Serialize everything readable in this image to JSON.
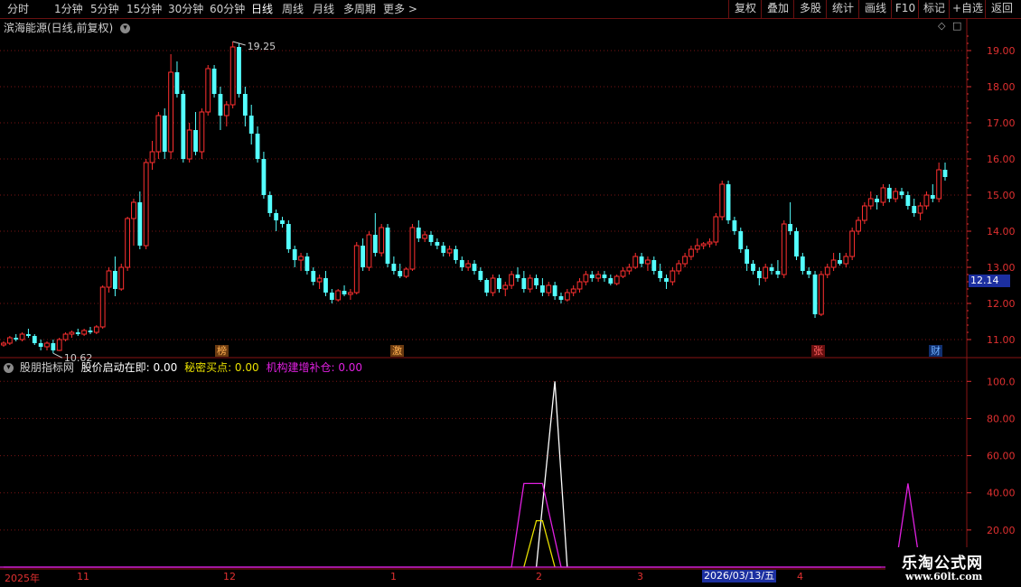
{
  "toolbar": {
    "periods": [
      "分时",
      "1分钟",
      "5分钟",
      "15分钟",
      "30分钟",
      "60分钟",
      "日线",
      "周线",
      "月线",
      "多周期",
      "更多 >"
    ],
    "active_period": "日线",
    "right_buttons": [
      "复权",
      "叠加",
      "多股",
      "统计",
      "画线",
      "F10",
      "标记",
      "+自选",
      "返回"
    ]
  },
  "chart_header": {
    "title": "滨海能源(日线,前复权)"
  },
  "indicator": {
    "name": "股朋指标网",
    "line1_label": "股价启动在即: 0.00",
    "line2_label": "秘密买点: 0.00",
    "line3_label": "机构建增补仓: 0.00"
  },
  "annotations": {
    "high_label": "19.25",
    "low_label": "10.62",
    "current_price": "12.14"
  },
  "event_tags": [
    {
      "text": "榜",
      "color": "#e07a1a"
    },
    {
      "text": "激",
      "color": "#e07a1a"
    },
    {
      "text": "张",
      "color": "#e03030"
    },
    {
      "text": "财",
      "color": "#2a7ae0"
    }
  ],
  "date_axis": [
    "2025年",
    "11",
    "12",
    "1",
    "2",
    "3",
    "2026/03/13/五",
    "4"
  ],
  "watermark": {
    "title": "乐淘公式网",
    "url": "www.60lt.com"
  },
  "colors": {
    "up": "#ff3030",
    "down": "#54ffff",
    "grid": "#7a1414",
    "axis_text": "#e03030",
    "ind_white": "#ffffff",
    "ind_yellow": "#e8e000",
    "ind_magenta": "#e020e0"
  },
  "chart_data": [
    {
      "type": "candlestick",
      "title": "滨海能源(日线,前复权)",
      "ylim": [
        10.6,
        19.5
      ],
      "y_ticks": [
        11.0,
        12.0,
        13.0,
        14.0,
        15.0,
        16.0,
        17.0,
        18.0,
        19.0
      ],
      "y_tick_labels": [
        "11.00",
        "12.00",
        "13.00",
        "14.00",
        "15.00",
        "16.00",
        "17.00",
        "18.00",
        "19.00"
      ],
      "x_labels": [
        "2025年",
        "11",
        "12",
        "1",
        "2",
        "3",
        "4"
      ],
      "ohlc": [
        [
          10.85,
          10.95,
          10.8,
          10.9
        ],
        [
          10.9,
          11.1,
          10.85,
          11.05
        ],
        [
          11.05,
          11.15,
          10.95,
          11.0
        ],
        [
          11.0,
          11.2,
          10.95,
          11.15
        ],
        [
          11.15,
          11.3,
          11.05,
          11.1
        ],
        [
          11.1,
          11.15,
          10.85,
          10.9
        ],
        [
          10.9,
          11.0,
          10.7,
          10.8
        ],
        [
          10.8,
          10.95,
          10.7,
          10.9
        ],
        [
          10.9,
          11.0,
          10.62,
          10.7
        ],
        [
          10.7,
          11.05,
          10.68,
          11.0
        ],
        [
          11.0,
          11.2,
          10.95,
          11.15
        ],
        [
          11.15,
          11.25,
          11.05,
          11.2
        ],
        [
          11.2,
          11.3,
          11.1,
          11.15
        ],
        [
          11.15,
          11.3,
          11.1,
          11.25
        ],
        [
          11.25,
          11.35,
          11.15,
          11.2
        ],
        [
          11.2,
          11.4,
          11.15,
          11.35
        ],
        [
          11.35,
          12.5,
          11.3,
          12.45
        ],
        [
          12.45,
          13.0,
          12.3,
          12.9
        ],
        [
          12.9,
          13.3,
          12.2,
          12.4
        ],
        [
          12.4,
          13.1,
          12.35,
          13.0
        ],
        [
          13.0,
          14.4,
          12.9,
          14.35
        ],
        [
          14.35,
          14.9,
          13.6,
          14.8
        ],
        [
          14.8,
          15.1,
          13.5,
          13.6
        ],
        [
          13.6,
          16.0,
          13.5,
          15.9
        ],
        [
          15.9,
          16.5,
          15.7,
          16.2
        ],
        [
          16.2,
          17.3,
          16.0,
          17.2
        ],
        [
          17.2,
          17.4,
          16.0,
          16.2
        ],
        [
          16.2,
          18.9,
          16.0,
          18.4
        ],
        [
          18.4,
          18.7,
          17.7,
          17.8
        ],
        [
          17.8,
          17.9,
          15.9,
          16.0
        ],
        [
          16.0,
          17.0,
          15.9,
          16.8
        ],
        [
          16.8,
          17.3,
          16.1,
          16.2
        ],
        [
          16.2,
          17.4,
          16.0,
          17.3
        ],
        [
          17.3,
          18.6,
          17.2,
          18.5
        ],
        [
          18.5,
          18.6,
          17.7,
          17.8
        ],
        [
          17.8,
          18.0,
          16.8,
          17.2
        ],
        [
          17.2,
          17.6,
          16.9,
          17.5
        ],
        [
          17.5,
          19.25,
          17.4,
          19.1
        ],
        [
          19.1,
          19.2,
          17.7,
          17.8
        ],
        [
          17.8,
          18.0,
          16.9,
          17.2
        ],
        [
          17.2,
          17.5,
          16.4,
          16.7
        ],
        [
          16.7,
          16.9,
          15.9,
          16.0
        ],
        [
          16.0,
          16.2,
          14.9,
          15.0
        ],
        [
          15.0,
          15.1,
          14.4,
          14.5
        ],
        [
          14.5,
          14.6,
          14.0,
          14.3
        ],
        [
          14.3,
          14.4,
          14.1,
          14.2
        ],
        [
          14.2,
          14.3,
          13.4,
          13.5
        ],
        [
          13.5,
          13.6,
          13.0,
          13.2
        ],
        [
          13.2,
          13.4,
          12.9,
          13.3
        ],
        [
          13.3,
          13.4,
          12.8,
          12.9
        ],
        [
          12.9,
          13.0,
          12.5,
          12.6
        ],
        [
          12.6,
          12.8,
          12.4,
          12.7
        ],
        [
          12.7,
          12.9,
          12.2,
          12.3
        ],
        [
          12.3,
          12.4,
          12.0,
          12.1
        ],
        [
          12.1,
          12.4,
          12.05,
          12.35
        ],
        [
          12.35,
          12.5,
          12.2,
          12.25
        ],
        [
          12.25,
          12.4,
          12.1,
          12.3
        ],
        [
          12.3,
          13.7,
          12.25,
          13.6
        ],
        [
          13.6,
          13.8,
          12.9,
          13.0
        ],
        [
          13.0,
          14.0,
          12.9,
          13.9
        ],
        [
          13.9,
          14.5,
          13.3,
          13.4
        ],
        [
          13.4,
          14.2,
          13.3,
          14.1
        ],
        [
          14.1,
          14.2,
          13.0,
          13.1
        ],
        [
          13.1,
          13.3,
          12.8,
          12.9
        ],
        [
          12.9,
          13.1,
          12.7,
          12.75
        ],
        [
          12.75,
          13.0,
          12.7,
          12.95
        ],
        [
          12.95,
          14.2,
          12.9,
          14.1
        ],
        [
          14.1,
          14.3,
          13.7,
          13.8
        ],
        [
          13.8,
          14.0,
          13.7,
          13.9
        ],
        [
          13.9,
          14.0,
          13.6,
          13.7
        ],
        [
          13.7,
          13.8,
          13.5,
          13.6
        ],
        [
          13.6,
          13.7,
          13.3,
          13.4
        ],
        [
          13.4,
          13.6,
          13.3,
          13.5
        ],
        [
          13.5,
          13.6,
          13.1,
          13.2
        ],
        [
          13.2,
          13.3,
          12.9,
          13.0
        ],
        [
          13.0,
          13.2,
          12.9,
          13.1
        ],
        [
          13.1,
          13.2,
          12.8,
          12.9
        ],
        [
          12.9,
          13.0,
          12.6,
          12.65
        ],
        [
          12.65,
          12.7,
          12.2,
          12.3
        ],
        [
          12.3,
          12.8,
          12.2,
          12.7
        ],
        [
          12.7,
          12.8,
          12.3,
          12.4
        ],
        [
          12.4,
          12.6,
          12.2,
          12.5
        ],
        [
          12.5,
          12.9,
          12.4,
          12.8
        ],
        [
          12.8,
          13.0,
          12.6,
          12.7
        ],
        [
          12.7,
          12.9,
          12.3,
          12.4
        ],
        [
          12.4,
          12.8,
          12.3,
          12.7
        ],
        [
          12.7,
          12.8,
          12.4,
          12.5
        ],
        [
          12.5,
          12.7,
          12.2,
          12.3
        ],
        [
          12.3,
          12.6,
          12.2,
          12.5
        ],
        [
          12.5,
          12.6,
          12.1,
          12.2
        ],
        [
          12.2,
          12.3,
          12.0,
          12.1
        ],
        [
          12.1,
          12.4,
          12.05,
          12.3
        ],
        [
          12.3,
          12.5,
          12.2,
          12.4
        ],
        [
          12.4,
          12.7,
          12.3,
          12.6
        ],
        [
          12.6,
          12.9,
          12.5,
          12.8
        ],
        [
          12.8,
          12.9,
          12.6,
          12.7
        ],
        [
          12.7,
          12.9,
          12.6,
          12.8
        ],
        [
          12.8,
          12.9,
          12.6,
          12.7
        ],
        [
          12.7,
          12.8,
          12.5,
          12.55
        ],
        [
          12.55,
          12.8,
          12.5,
          12.75
        ],
        [
          12.75,
          13.0,
          12.7,
          12.9
        ],
        [
          12.9,
          13.1,
          12.8,
          13.0
        ],
        [
          13.0,
          13.4,
          12.95,
          13.3
        ],
        [
          13.3,
          13.4,
          13.0,
          13.1
        ],
        [
          13.1,
          13.3,
          12.9,
          13.2
        ],
        [
          13.2,
          13.3,
          12.8,
          12.9
        ],
        [
          12.9,
          13.1,
          12.6,
          12.7
        ],
        [
          12.7,
          12.8,
          12.4,
          12.6
        ],
        [
          12.6,
          13.0,
          12.5,
          12.9
        ],
        [
          12.9,
          13.2,
          12.8,
          13.1
        ],
        [
          13.1,
          13.4,
          13.0,
          13.3
        ],
        [
          13.3,
          13.6,
          13.2,
          13.5
        ],
        [
          13.5,
          13.8,
          13.4,
          13.6
        ],
        [
          13.6,
          13.7,
          13.5,
          13.65
        ],
        [
          13.65,
          13.8,
          13.55,
          13.7
        ],
        [
          13.7,
          14.5,
          13.6,
          14.4
        ],
        [
          14.4,
          15.4,
          14.3,
          15.3
        ],
        [
          15.3,
          15.4,
          14.2,
          14.3
        ],
        [
          14.3,
          14.4,
          13.9,
          14.0
        ],
        [
          14.0,
          14.1,
          13.4,
          13.5
        ],
        [
          13.5,
          13.6,
          12.9,
          13.1
        ],
        [
          13.1,
          13.2,
          12.8,
          12.9
        ],
        [
          12.9,
          13.0,
          12.5,
          12.7
        ],
        [
          12.7,
          13.1,
          12.6,
          13.0
        ],
        [
          13.0,
          13.1,
          12.8,
          12.9
        ],
        [
          12.9,
          13.2,
          12.7,
          12.8
        ],
        [
          12.8,
          14.3,
          12.7,
          14.2
        ],
        [
          14.2,
          14.8,
          13.9,
          14.0
        ],
        [
          14.0,
          14.1,
          13.2,
          13.3
        ],
        [
          13.3,
          13.4,
          12.8,
          12.9
        ],
        [
          12.9,
          13.0,
          12.7,
          12.8
        ],
        [
          12.8,
          12.9,
          11.6,
          11.7
        ],
        [
          11.7,
          12.9,
          11.65,
          12.8
        ],
        [
          12.8,
          13.1,
          12.7,
          13.0
        ],
        [
          13.0,
          13.4,
          12.9,
          13.2
        ],
        [
          13.2,
          13.4,
          13.05,
          13.1
        ],
        [
          13.1,
          13.4,
          13.0,
          13.3
        ],
        [
          13.3,
          14.1,
          13.2,
          14.0
        ],
        [
          14.0,
          14.4,
          13.9,
          14.3
        ],
        [
          14.3,
          14.8,
          14.2,
          14.7
        ],
        [
          14.7,
          15.1,
          14.6,
          14.9
        ],
        [
          14.9,
          15.0,
          14.6,
          14.8
        ],
        [
          14.8,
          15.3,
          14.7,
          15.2
        ],
        [
          15.2,
          15.3,
          14.8,
          14.9
        ],
        [
          14.9,
          15.2,
          14.8,
          15.1
        ],
        [
          15.1,
          15.2,
          14.9,
          15.0
        ],
        [
          15.0,
          15.1,
          14.6,
          14.7
        ],
        [
          14.7,
          14.9,
          14.4,
          14.5
        ],
        [
          14.5,
          14.8,
          14.3,
          14.7
        ],
        [
          14.7,
          15.1,
          14.6,
          15.0
        ],
        [
          15.0,
          15.3,
          14.8,
          14.9
        ],
        [
          14.9,
          15.9,
          14.8,
          15.7
        ],
        [
          15.7,
          15.9,
          15.4,
          15.5
        ]
      ]
    },
    {
      "type": "line",
      "title": "股朋指标网",
      "ylim": [
        0,
        105
      ],
      "y_ticks": [
        20,
        40,
        60,
        80,
        100
      ],
      "y_tick_labels": [
        "20.00",
        "40.00",
        "60.00",
        "80.00",
        "100.0"
      ],
      "series": [
        {
          "name": "股价启动在即",
          "color": "#ffffff",
          "points": [
            [
              86,
              0
            ],
            [
              89,
              100
            ],
            [
              91,
              0
            ]
          ]
        },
        {
          "name": "秘密买点",
          "color": "#e8e000",
          "points": [
            [
              84,
              0
            ],
            [
              86,
              25
            ],
            [
              87,
              25
            ],
            [
              89,
              0
            ]
          ]
        },
        {
          "name": "机构建增补仓",
          "color": "#e020e0",
          "points": [
            [
              0,
              0
            ],
            [
              82,
              0
            ],
            [
              84,
              45
            ],
            [
              87,
              45
            ],
            [
              90,
              0
            ],
            [
              144,
              0
            ],
            [
              146,
              45
            ],
            [
              148,
              0
            ],
            [
              239,
              0
            ]
          ]
        }
      ]
    }
  ]
}
